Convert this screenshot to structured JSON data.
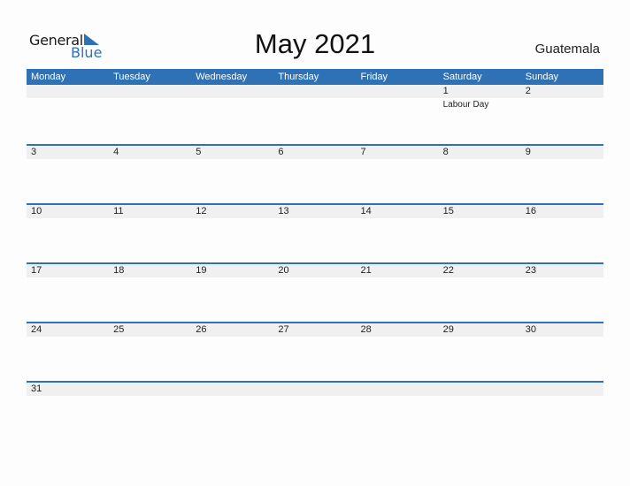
{
  "logo": {
    "part1": "General",
    "part2": "Blue",
    "icon": "triangle-flag-icon"
  },
  "title": "May 2021",
  "country": "Guatemala",
  "colors": {
    "accent": "#2e72b5",
    "band": "#f0f0f0"
  },
  "weekdays": [
    "Monday",
    "Tuesday",
    "Wednesday",
    "Thursday",
    "Friday",
    "Saturday",
    "Sunday"
  ],
  "weeks": [
    [
      {
        "day": ""
      },
      {
        "day": ""
      },
      {
        "day": ""
      },
      {
        "day": ""
      },
      {
        "day": ""
      },
      {
        "day": "1",
        "event": "Labour Day"
      },
      {
        "day": "2"
      }
    ],
    [
      {
        "day": "3"
      },
      {
        "day": "4"
      },
      {
        "day": "5"
      },
      {
        "day": "6"
      },
      {
        "day": "7"
      },
      {
        "day": "8"
      },
      {
        "day": "9"
      }
    ],
    [
      {
        "day": "10"
      },
      {
        "day": "11"
      },
      {
        "day": "12"
      },
      {
        "day": "13"
      },
      {
        "day": "14"
      },
      {
        "day": "15"
      },
      {
        "day": "16"
      }
    ],
    [
      {
        "day": "17"
      },
      {
        "day": "18"
      },
      {
        "day": "19"
      },
      {
        "day": "20"
      },
      {
        "day": "21"
      },
      {
        "day": "22"
      },
      {
        "day": "23"
      }
    ],
    [
      {
        "day": "24"
      },
      {
        "day": "25"
      },
      {
        "day": "26"
      },
      {
        "day": "27"
      },
      {
        "day": "28"
      },
      {
        "day": "29"
      },
      {
        "day": "30"
      }
    ],
    [
      {
        "day": "31"
      },
      {
        "day": ""
      },
      {
        "day": ""
      },
      {
        "day": ""
      },
      {
        "day": ""
      },
      {
        "day": ""
      },
      {
        "day": ""
      }
    ]
  ]
}
